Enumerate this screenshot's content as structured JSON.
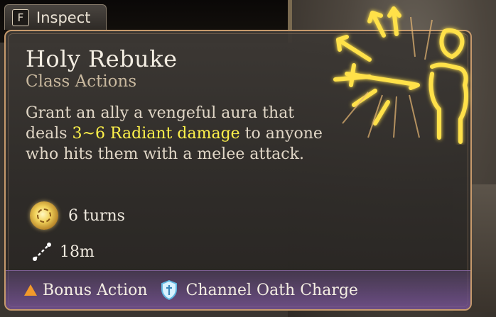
{
  "inspect": {
    "key": "F",
    "label": "Inspect"
  },
  "spell": {
    "name": "Holy Rebuke",
    "category": "Class Actions",
    "description_before": "Grant an ally a vengeful aura that deals ",
    "description_highlight": "3~6 Radiant damage",
    "description_after": " to anyone who hits them with a melee attack.",
    "duration": "6 turns",
    "range": "18m",
    "costs": [
      {
        "icon": "bonus-action-triangle-icon",
        "label": "Bonus Action"
      },
      {
        "icon": "channel-oath-shield-icon",
        "label": "Channel Oath Charge"
      }
    ]
  },
  "colors": {
    "border": "#c79a6c",
    "highlight": "#fff24a",
    "bonus_action": "#f29a2a",
    "footer": "#7a5596",
    "spell_glow": "#ffe14a"
  }
}
